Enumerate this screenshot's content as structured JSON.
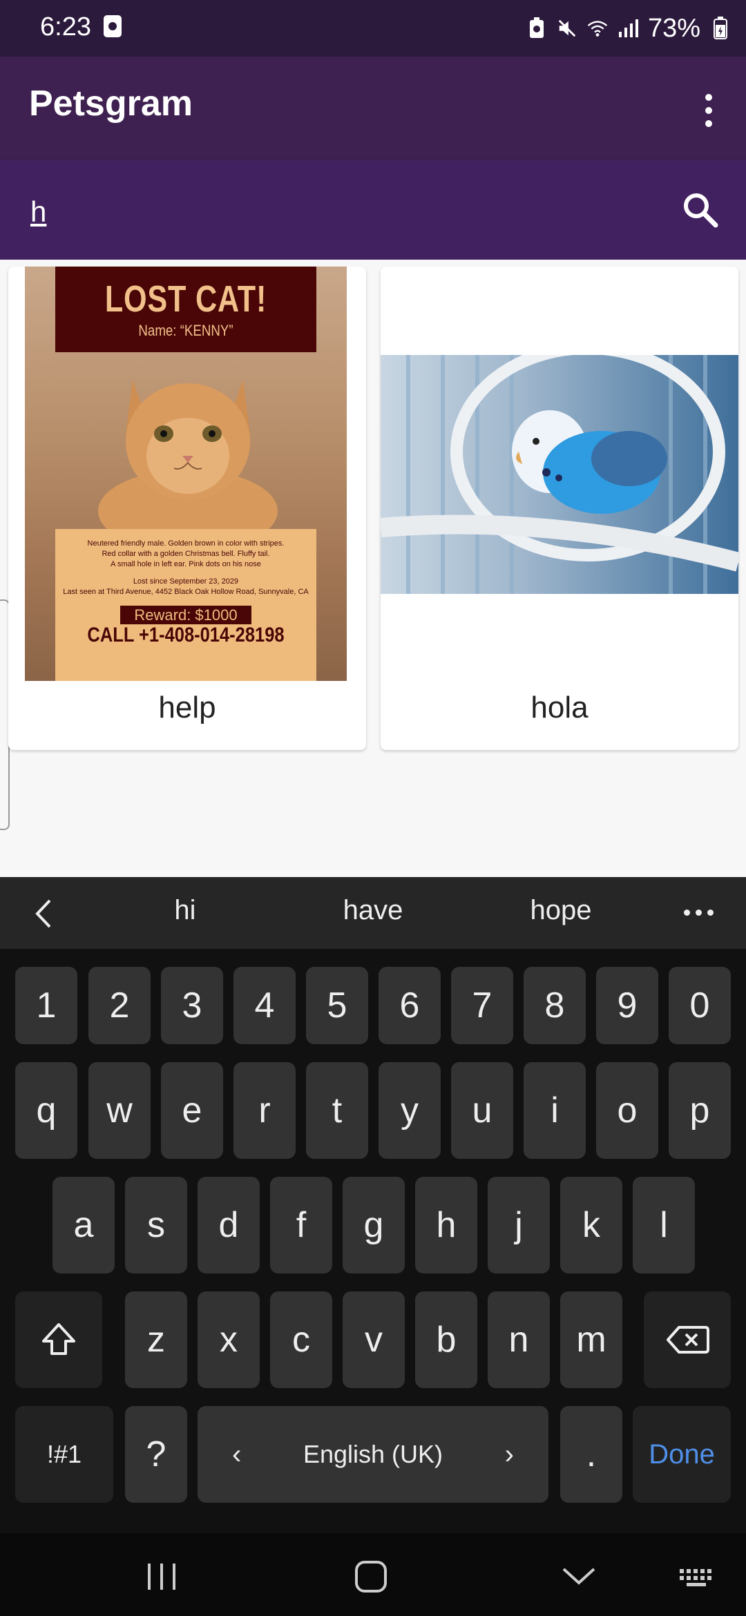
{
  "status_bar": {
    "time": "6:23",
    "battery": "73%"
  },
  "app_bar": {
    "title": "Petsgram"
  },
  "search": {
    "value": "h",
    "placeholder": ""
  },
  "cards": [
    {
      "label": "help",
      "poster": {
        "title": "LOST CAT!",
        "name": "Name: “KENNY”",
        "lines": [
          "Neutered friendly male. Golden brown in color with stripes.",
          "Red collar with a golden Christmas bell. Fluffy tail.",
          "A small hole in left ear. Pink dots on his nose",
          "Lost since September 23, 2029",
          "Last seen at Third Avenue, 4452 Black Oak Hollow Road, Sunnyvale, CA"
        ],
        "reward": "Reward: $1000",
        "call": "CALL +1-408-014-28198"
      }
    },
    {
      "label": "hola"
    }
  ],
  "keyboard": {
    "suggestions": [
      "hi",
      "have",
      "hope"
    ],
    "rows": {
      "numbers": [
        "1",
        "2",
        "3",
        "4",
        "5",
        "6",
        "7",
        "8",
        "9",
        "0"
      ],
      "row1": [
        "q",
        "w",
        "e",
        "r",
        "t",
        "y",
        "u",
        "i",
        "o",
        "p"
      ],
      "row2": [
        "a",
        "s",
        "d",
        "f",
        "g",
        "h",
        "j",
        "k",
        "l"
      ],
      "row3": [
        "z",
        "x",
        "c",
        "v",
        "b",
        "n",
        "m"
      ]
    },
    "symbols_key": "!#1",
    "question_key": "?",
    "space_label": "English (UK)",
    "period_key": ".",
    "done_label": "Done"
  },
  "colors": {
    "status_bar": "#2c1a3c",
    "app_bar": "#3e2150",
    "search_bar": "#41215f",
    "done": "#4f8fe8"
  }
}
